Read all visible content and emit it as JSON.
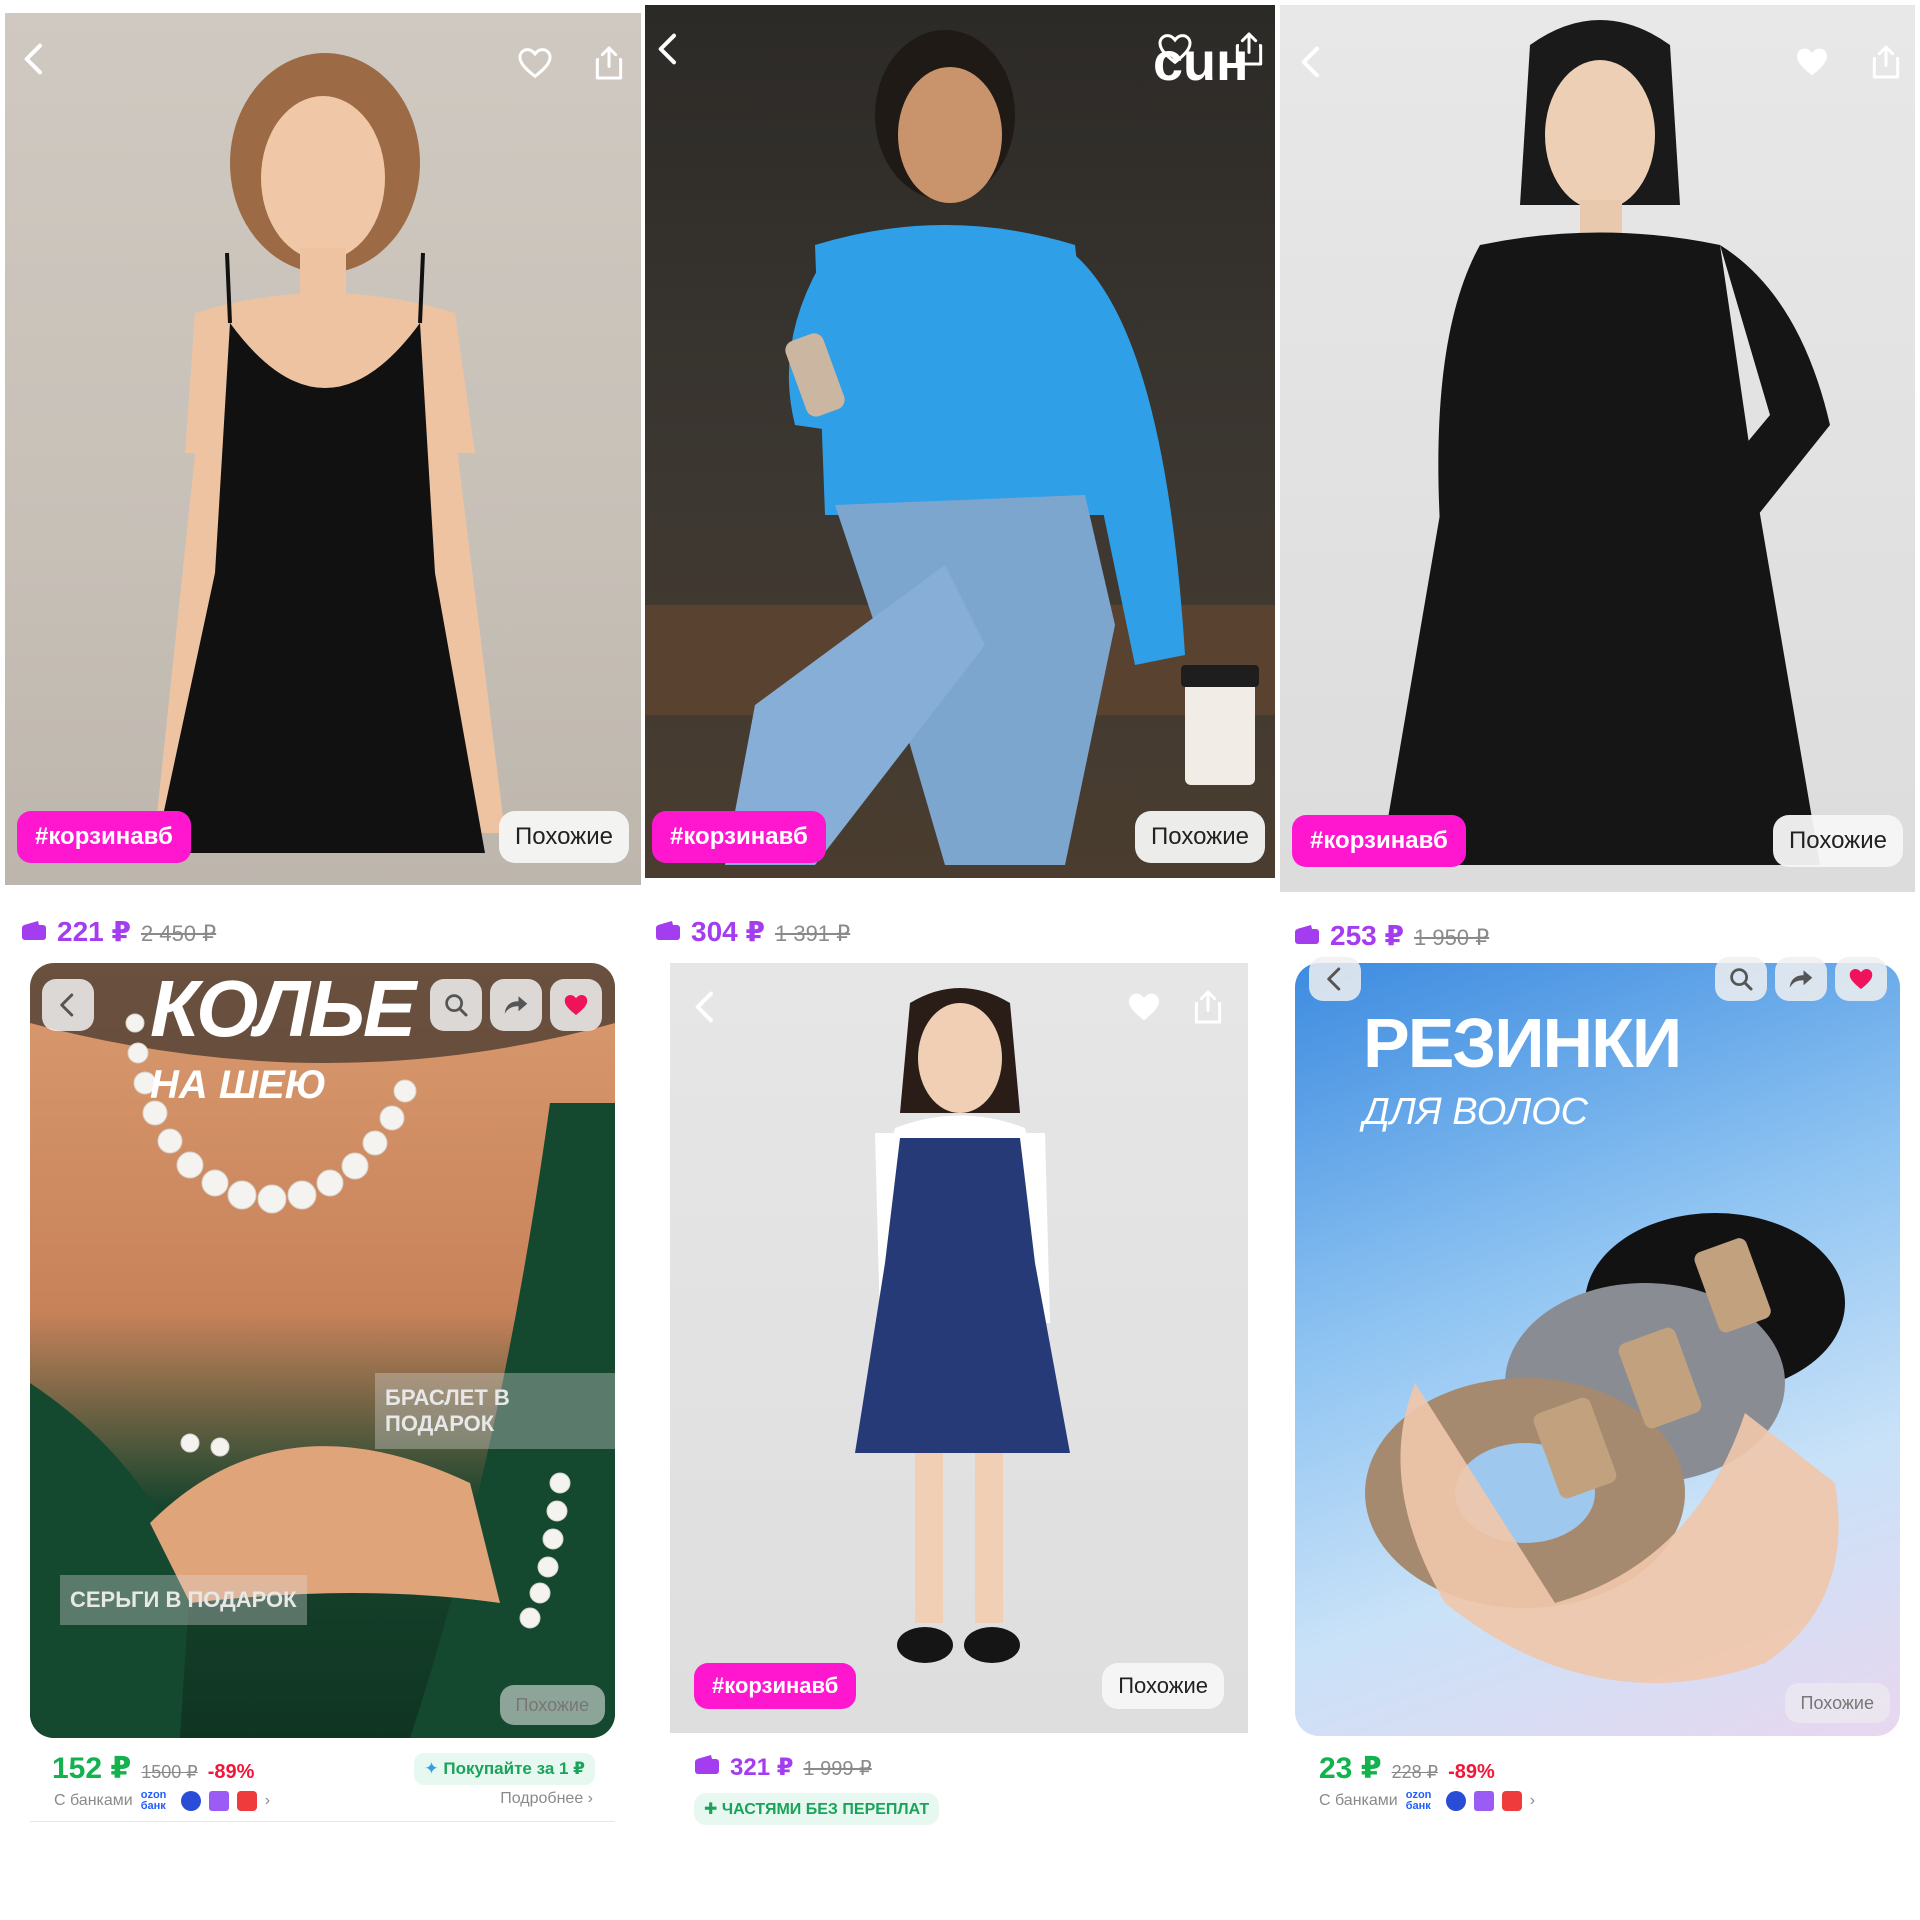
{
  "cards": [
    {
      "tag": "#корзинавб",
      "similar": "Похожие",
      "price": "221 ₽",
      "old_price": "2 450 ₽"
    },
    {
      "tag": "#корзинавб",
      "similar": "Похожие",
      "price": "304 ₽",
      "old_price": "1 391 ₽",
      "brand_overlay": "сuн"
    },
    {
      "tag": "#корзинавб",
      "similar": "Похожие",
      "price": "253 ₽",
      "old_price": "1 950 ₽"
    },
    {
      "title": "КОЛЬЕ",
      "subtitle": "НА ШЕЮ",
      "label_bracelet": "БРАСЛЕТ В ПОДАРОК",
      "label_earrings": "СЕРЬГИ В ПОДАРОК",
      "similar": "Похожие",
      "price": "152 ₽",
      "old_price": "1500 ₽",
      "discount": "-89%",
      "promo": "Покупайте за 1 ₽",
      "banks_label": "С банками",
      "bank_ozon": "ozon банк",
      "more": "Подробнее"
    },
    {
      "tag": "#корзинавб",
      "similar": "Похожие",
      "price": "321 ₽",
      "old_price": "1 999 ₽",
      "installments": "ЧАСТЯМИ БЕЗ ПЕРЕПЛАТ"
    },
    {
      "title": "РЕЗИНКИ",
      "subtitle": "ДЛЯ ВОЛОС",
      "similar": "Похожие",
      "price": "23 ₽",
      "old_price": "228 ₽",
      "discount": "-89%",
      "banks_label": "С банками",
      "bank_ozon": "ozon банк"
    }
  ],
  "colors": {
    "tag_bg": "#ff17d0",
    "price_purple": "#a43cf0",
    "price_green": "#12b24d",
    "discount_red": "#f3163b"
  }
}
